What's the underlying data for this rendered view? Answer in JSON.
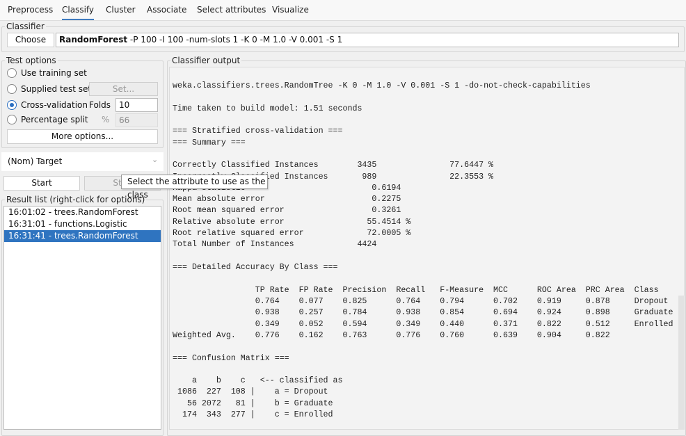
{
  "tabs": [
    "Preprocess",
    "Classify",
    "Cluster",
    "Associate",
    "Select attributes",
    "Visualize"
  ],
  "classifier": {
    "label": "Classifier",
    "choose": "Choose",
    "name": "RandomForest",
    "options": " -P 100 -I 100 -num-slots 1 -K 0 -M 1.0 -V 0.001 -S 1"
  },
  "test_options": {
    "label": "Test options",
    "use_training": "Use training set",
    "supplied": "Supplied test set",
    "set_button": "Set...",
    "cross_validation": "Cross-validation",
    "folds_label": "Folds",
    "folds_value": "10",
    "percentage": "Percentage split",
    "percent_sign": "%",
    "percent_value": "66",
    "more_options": "More options...",
    "selected": "Cross-validation"
  },
  "class_select": {
    "value": "(Nom) Target"
  },
  "start": "Start",
  "stop": "Stop",
  "tooltip": "Select the attribute to use as the class",
  "result_list": {
    "label": "Result list (right-click for options)",
    "items": [
      "16:01:02 - trees.RandomForest",
      "16:31:01 - functions.Logistic",
      "16:31:41 - trees.RandomForest"
    ],
    "selected_index": 2
  },
  "output": {
    "label": "Classifier output",
    "lines": [
      "weka.classifiers.trees.RandomTree -K 0 -M 1.0 -V 0.001 -S 1 -do-not-check-capabilities",
      "",
      "Time taken to build model: 1.51 seconds",
      "",
      "=== Stratified cross-validation ===",
      "=== Summary ===",
      "",
      "Correctly Classified Instances        3435               77.6447 %",
      "Incorrectly Classified Instances       989               22.3553 %",
      "Kappa statistic                          0.6194",
      "Mean absolute error                      0.2275",
      "Root mean squared error                  0.3261",
      "Relative absolute error                 55.4514 %",
      "Root relative squared error             72.0005 %",
      "Total Number of Instances             4424",
      "",
      "=== Detailed Accuracy By Class ===",
      "",
      "                 TP Rate  FP Rate  Precision  Recall   F-Measure  MCC      ROC Area  PRC Area  Class",
      "                 0.764    0.077    0.825      0.764    0.794      0.702    0.919     0.878     Dropout",
      "                 0.938    0.257    0.784      0.938    0.854      0.694    0.924     0.898     Graduate",
      "                 0.349    0.052    0.594      0.349    0.440      0.371    0.822     0.512     Enrolled",
      "Weighted Avg.    0.776    0.162    0.763      0.776    0.760      0.639    0.904     0.822",
      "",
      "=== Confusion Matrix ===",
      "",
      "    a    b    c   <-- classified as",
      " 1086  227  108 |    a = Dropout",
      "   56 2072   81 |    b = Graduate",
      "  174  343  277 |    c = Enrolled"
    ]
  }
}
